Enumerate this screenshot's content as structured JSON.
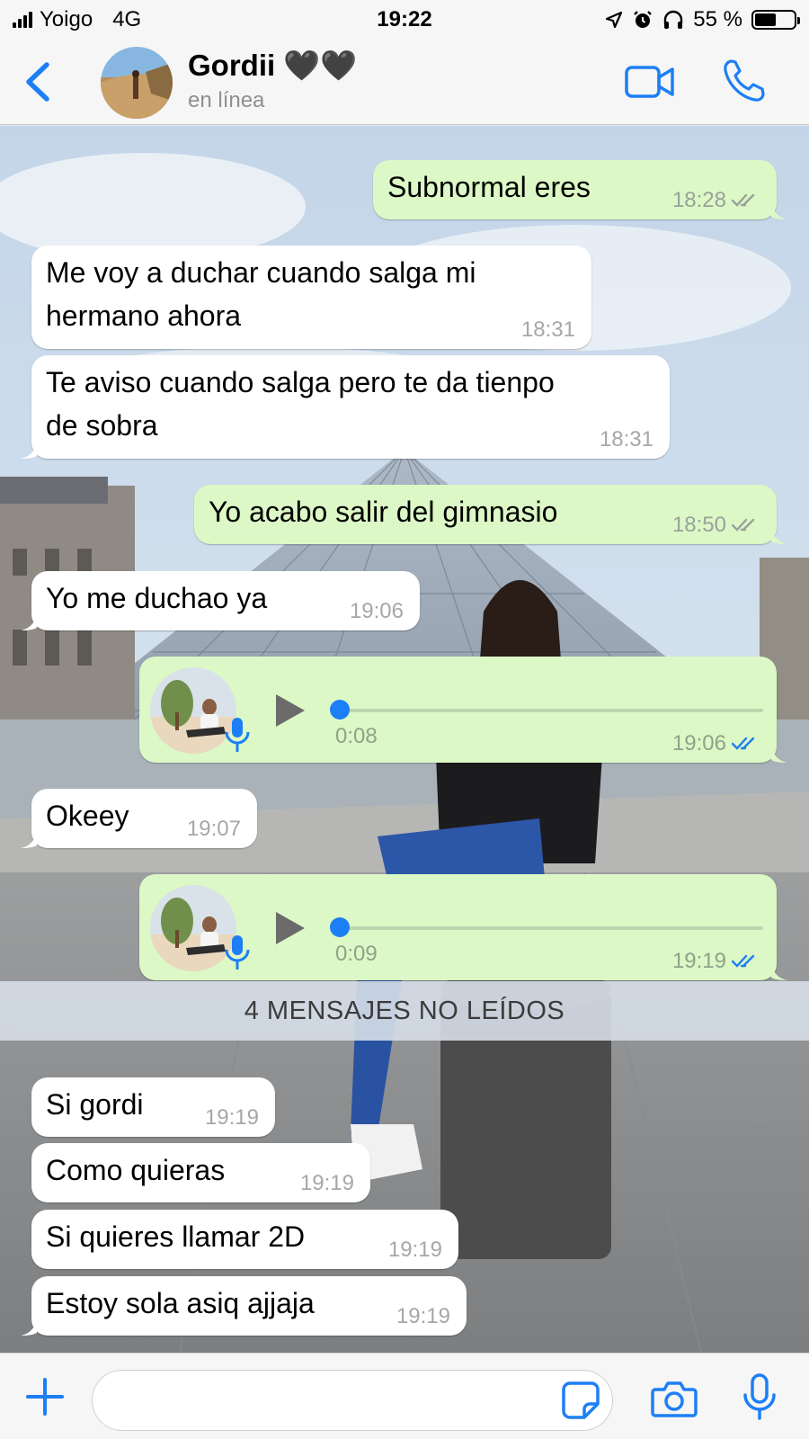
{
  "status_bar": {
    "carrier": "Yoigo",
    "network": "4G",
    "time": "19:22",
    "battery": "55 %",
    "battery_level": 0.55,
    "icons": [
      "signal-bars-icon",
      "location-arrow-icon",
      "alarm-clock-icon",
      "headphones-icon",
      "battery-icon"
    ]
  },
  "header": {
    "back_icon": "chevron-left-icon",
    "contact_name": "Gordii 🖤🖤",
    "status": "en línea",
    "video_icon": "video-camera-icon",
    "call_icon": "phone-icon",
    "accent_color": "#1d7ff5"
  },
  "messages": [
    {
      "direction": "out",
      "text": "Subnormal eres",
      "time": "18:28",
      "ticks": "read-grey"
    },
    {
      "direction": "in",
      "text_lines": [
        "Me voy a duchar cuando salga mi",
        "hermano ahora"
      ],
      "time": "18:31"
    },
    {
      "direction": "in",
      "text_lines": [
        "Te aviso cuando salga pero te da tienpo",
        "de sobra"
      ],
      "time": "18:31"
    },
    {
      "direction": "out",
      "text": "Yo acabo salir del gimnasio",
      "time": "18:50",
      "ticks": "read-grey"
    },
    {
      "direction": "in",
      "text": "Yo me duchao ya",
      "time": "19:06"
    },
    {
      "direction": "out",
      "type": "voice",
      "duration": "0:08",
      "time": "19:06",
      "ticks": "read-blue",
      "progress": 0
    },
    {
      "direction": "in",
      "text": "Okeey",
      "time": "19:07"
    },
    {
      "direction": "out",
      "type": "voice",
      "duration": "0:09",
      "time": "19:19",
      "ticks": "read-blue",
      "progress": 0
    },
    {
      "direction": "in",
      "text": "Si gordi",
      "time": "19:19"
    },
    {
      "direction": "in",
      "text": "Como quieras",
      "time": "19:19"
    },
    {
      "direction": "in",
      "text": "Si quieres llamar 2D",
      "time": "19:19"
    },
    {
      "direction": "in",
      "text": "Estoy sola asiq ajjaja",
      "time": "19:19"
    }
  ],
  "unread_divider": "4 MENSAJES NO LEÍDOS",
  "input_bar": {
    "value": "",
    "placeholder": "",
    "icons": [
      "plus-icon",
      "sticker-icon",
      "camera-icon",
      "microphone-icon"
    ]
  },
  "colors": {
    "outgoing_bubble": "#dcf8c6",
    "incoming_bubble": "#ffffff",
    "read_tick_blue": "#1d7ff5"
  }
}
